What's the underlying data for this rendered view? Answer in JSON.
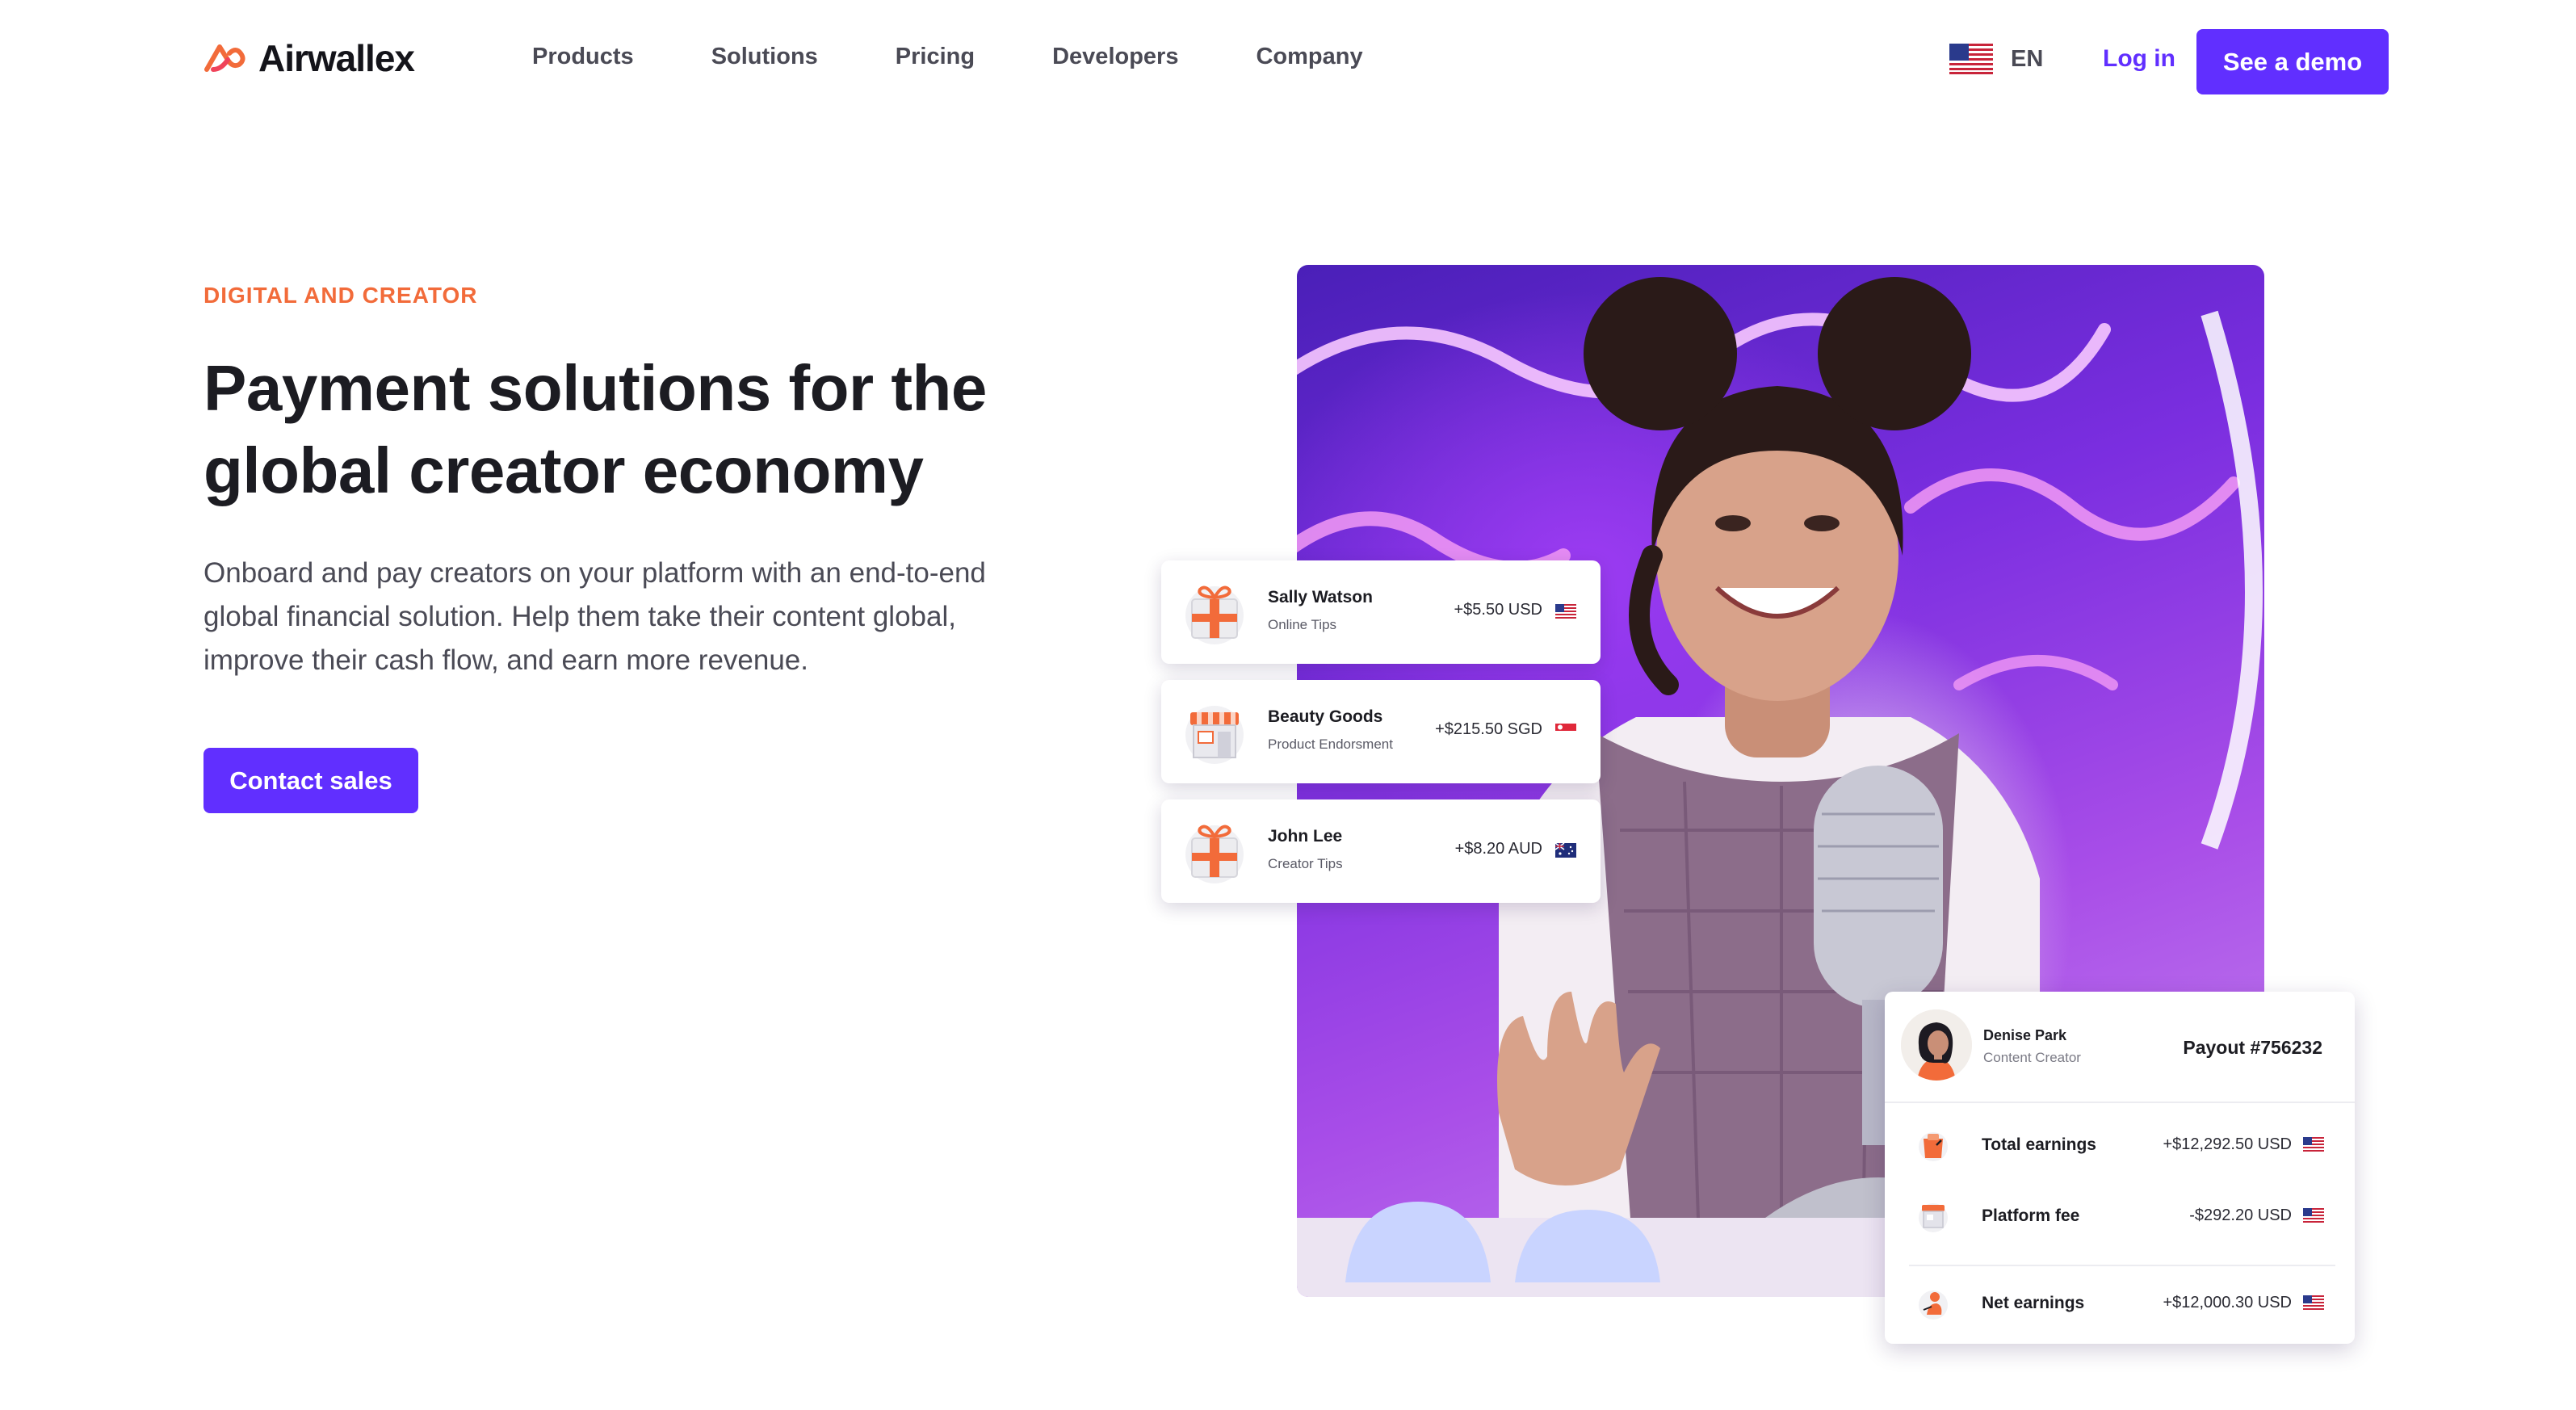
{
  "header": {
    "logo_text": "Airwallex",
    "nav": [
      "Products",
      "Solutions",
      "Pricing",
      "Developers",
      "Company"
    ],
    "language": "EN",
    "login": "Log in",
    "demo": "See a demo"
  },
  "hero": {
    "eyebrow": "DIGITAL AND CREATOR",
    "headline": "Payment solutions for the global creator economy",
    "subtext": "Onboard and pay creators on your platform with an end-to-end global financial solution. Help them take their content global, improve their cash flow, and earn more revenue.",
    "cta": "Contact sales"
  },
  "transactions": [
    {
      "name": "Sally Watson",
      "type": "Online Tips",
      "amount": "+$5.50 USD",
      "flag": "us-flag-icon",
      "icon": "gift-icon"
    },
    {
      "name": "Beauty Goods",
      "type": "Product Endorsment",
      "amount": "+$215.50 SGD",
      "flag": "sg-flag-icon",
      "icon": "storefront-icon"
    },
    {
      "name": "John Lee",
      "type": "Creator Tips",
      "amount": "+$8.20 AUD",
      "flag": "au-flag-icon",
      "icon": "gift-icon"
    }
  ],
  "payout": {
    "person": "Denise Park",
    "role": "Content Creator",
    "title": "Payout #756232",
    "rows": [
      {
        "label": "Total earnings",
        "value": "+$12,292.50 USD",
        "icon": "wallet-icon"
      },
      {
        "label": "Platform fee",
        "value": "-$292.20 USD",
        "icon": "storefront-icon"
      },
      {
        "label": "Net earnings",
        "value": "+$12,000.30 USD",
        "icon": "creator-icon"
      }
    ]
  },
  "colors": {
    "brand": "#612fff",
    "accent": "#f26b3a",
    "text": "#1c1c22"
  }
}
